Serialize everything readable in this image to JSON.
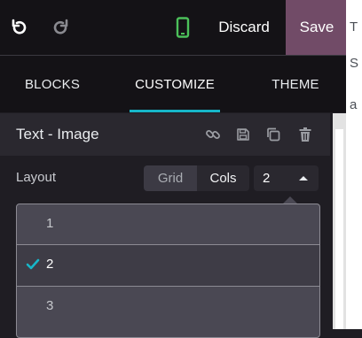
{
  "toolbar": {
    "undo_icon": "undo-icon",
    "redo_icon": "redo-icon",
    "mobile_icon": "mobile-preview-icon",
    "discard_label": "Discard",
    "save_label": "Save"
  },
  "tabs": [
    {
      "label": "BLOCKS"
    },
    {
      "label": "CUSTOMIZE",
      "active": true
    },
    {
      "label": "THEME"
    }
  ],
  "section": {
    "title": "Text - Image",
    "icons": [
      "link-icon",
      "save-icon",
      "clone-icon",
      "trash-icon"
    ]
  },
  "layout": {
    "label": "Layout",
    "segments": [
      "Grid",
      "Cols"
    ],
    "selected_segment": "Cols",
    "select_value": "2",
    "options": [
      "1",
      "2",
      "3"
    ],
    "selected_option": "2"
  },
  "colors": {
    "accent": "#17b6c8",
    "save_button": "#714b67",
    "mobile_icon": "#4cc05a"
  }
}
